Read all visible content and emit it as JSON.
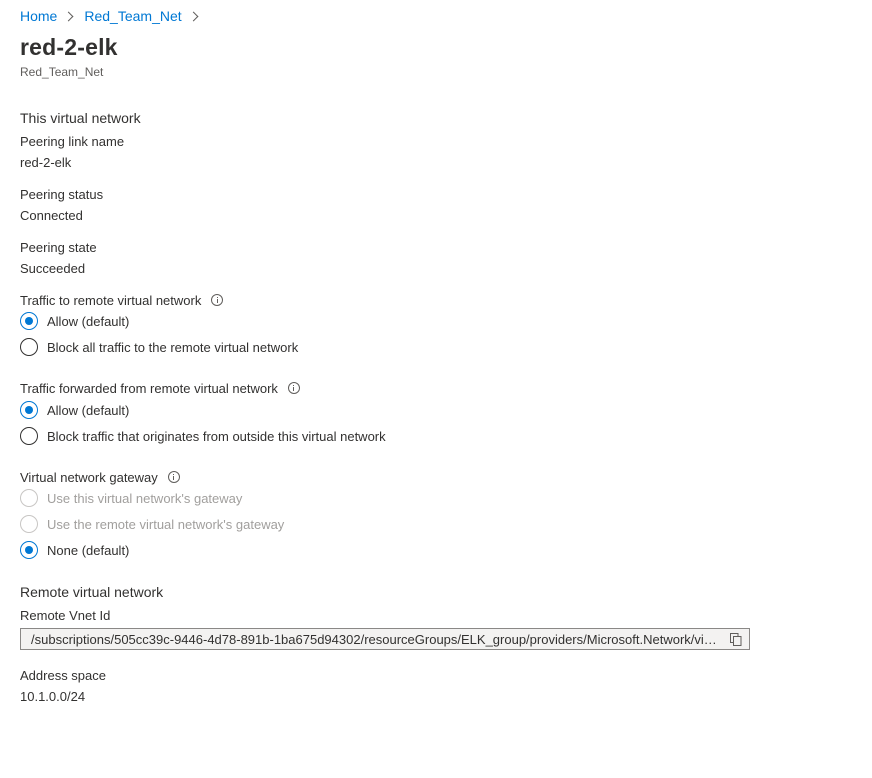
{
  "breadcrumb": {
    "items": [
      "Home",
      "Red_Team_Net"
    ]
  },
  "header": {
    "title": "red-2-elk",
    "subtitle": "Red_Team_Net"
  },
  "this_vnet": {
    "section_title": "This virtual network",
    "peering_link_name_label": "Peering link name",
    "peering_link_name_value": "red-2-elk",
    "peering_status_label": "Peering status",
    "peering_status_value": "Connected",
    "peering_state_label": "Peering state",
    "peering_state_value": "Succeeded"
  },
  "traffic_to_remote": {
    "label": "Traffic to remote virtual network",
    "options": [
      "Allow (default)",
      "Block all traffic to the remote virtual network"
    ],
    "selected": "Allow (default)"
  },
  "traffic_forwarded": {
    "label": "Traffic forwarded from remote virtual network",
    "options": [
      "Allow (default)",
      "Block traffic that originates from outside this virtual network"
    ],
    "selected": "Allow (default)"
  },
  "gateway": {
    "label": "Virtual network gateway",
    "options": [
      "Use this virtual network's gateway",
      "Use the remote virtual network's gateway",
      "None (default)"
    ],
    "disabled_options": [
      "Use this virtual network's gateway",
      "Use the remote virtual network's gateway"
    ],
    "selected": "None (default)"
  },
  "remote_vnet": {
    "section_title": "Remote virtual network",
    "vnet_id_label": "Remote Vnet Id",
    "vnet_id_value": "/subscriptions/505cc39c-9446-4d78-891b-1ba675d94302/resourceGroups/ELK_group/providers/Microsoft.Network/virt...",
    "address_space_label": "Address space",
    "address_space_value": "10.1.0.0/24"
  },
  "icons": {
    "breadcrumb_separator": "chevron-right-icon",
    "info": "info-icon",
    "copy": "copy-icon"
  },
  "colors": {
    "accent": "#0078d4",
    "text": "#323130",
    "disabled_text": "#a19f9d"
  }
}
